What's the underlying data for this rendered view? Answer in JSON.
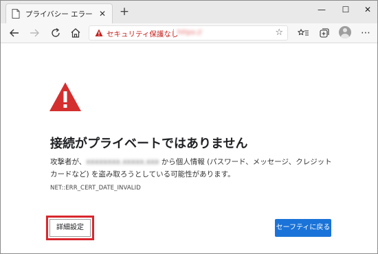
{
  "tab": {
    "title": "プライバシー エラー",
    "close_icon": "close-icon",
    "new_tab_icon": "plus-icon"
  },
  "window_controls": [
    "minimize-icon",
    "maximize-icon",
    "close-icon"
  ],
  "toolbar": {
    "icons": [
      "back-arrow-icon",
      "forward-arrow-icon",
      "refresh-icon",
      "home-icon",
      "favorite-star-icon",
      "favorites-list-icon",
      "collections-icon",
      "profile-avatar",
      "more-menu-icon"
    ]
  },
  "address_bar": {
    "security_label": "セキュリティ保護なし",
    "url": "https://",
    "security_color": "#c5221f"
  },
  "error_page": {
    "title": "接続がプライベートではありません",
    "desc_prefix": "攻撃者が、",
    "desc_domain_blurred": "",
    "desc_suffix": " から個人情報 (パスワード、メッセージ、クレジットカードなど) を盗み取ろうとしている可能性があります。",
    "error_code": "NET::ERR_CERT_DATE_INVALID",
    "details_button": "詳細設定",
    "back_button": "セーフティに戻る",
    "warning_color": "#d32f2f",
    "primary_color": "#1a73d8",
    "highlight_color": "#d9272d"
  }
}
